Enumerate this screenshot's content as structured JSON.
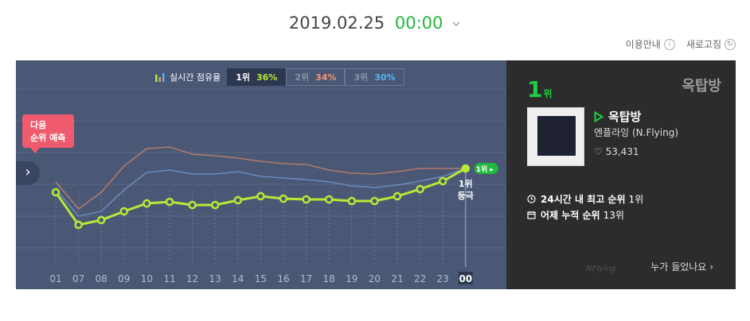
{
  "header": {
    "date": "2019.02.25",
    "time": "00:00"
  },
  "utility": {
    "guide_label": "이용안내",
    "guide_icon": "info-icon",
    "refresh_label": "새로고침",
    "refresh_icon": "refresh-icon"
  },
  "legend": {
    "label": "실시간 점유율",
    "tabs": [
      {
        "rank": "1위",
        "pct": "36%"
      },
      {
        "rank": "2위",
        "pct": "34%"
      },
      {
        "rank": "3위",
        "pct": "30%"
      }
    ]
  },
  "predict": {
    "line1": "다음",
    "line2": "순위 예측"
  },
  "chart_data": {
    "type": "line",
    "x": [
      "01",
      "07",
      "08",
      "09",
      "10",
      "11",
      "12",
      "13",
      "14",
      "15",
      "16",
      "17",
      "18",
      "19",
      "20",
      "21",
      "22",
      "23",
      "00"
    ],
    "series": [
      {
        "name": "1위",
        "color": "#b6ea35",
        "values": [
          242,
          283,
          277,
          266,
          256,
          254,
          258,
          258,
          252,
          247,
          250,
          251,
          251,
          253,
          253,
          247,
          238,
          228,
          212
        ]
      },
      {
        "name": "2위",
        "color": "#b07a6c",
        "values": [
          229,
          263,
          242,
          209,
          187,
          185,
          194,
          196,
          199,
          203,
          206,
          207,
          214,
          218,
          219,
          216,
          212,
          212,
          212
        ]
      },
      {
        "name": "3위",
        "color": "#6b89bd",
        "values": [
          238,
          272,
          266,
          239,
          217,
          214,
          219,
          219,
          216,
          222,
          224,
          226,
          229,
          234,
          236,
          233,
          228,
          222,
          212
        ]
      }
    ],
    "highlight": {
      "x": "00",
      "badge": "1위",
      "label_line1": "1위",
      "label_line2": "등극"
    },
    "grid": true
  },
  "side": {
    "bg_title": "옥탑방",
    "rank": "1",
    "rank_unit": "위",
    "song": "옥탑방",
    "artist": "엔플라잉 (N.Flying)",
    "likes": "53,431",
    "stat1_label": "24시간 내 최고 순위",
    "stat1_value": "1위",
    "stat2_label": "어제 누적 순위",
    "stat2_value": "13위",
    "who_label": "누가 들었나요",
    "brand": "NFlying"
  }
}
